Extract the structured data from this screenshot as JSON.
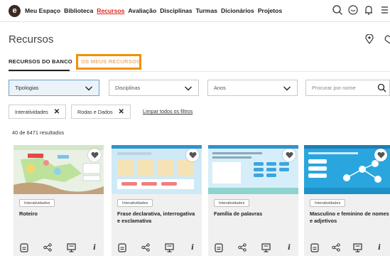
{
  "nav": {
    "logo_letter": "e",
    "links": [
      {
        "label": "Meu Espaço",
        "active": false
      },
      {
        "label": "Biblioteca",
        "active": false
      },
      {
        "label": "Recursos",
        "active": true
      },
      {
        "label": "Avaliação",
        "active": false
      },
      {
        "label": "Disciplinas",
        "active": false
      },
      {
        "label": "Turmas",
        "active": false
      },
      {
        "label": "Dicionários",
        "active": false
      },
      {
        "label": "Projetos",
        "active": false
      }
    ],
    "icons": [
      "search-icon",
      "chat-icon",
      "bell-icon",
      "menu-icon"
    ]
  },
  "page": {
    "title": "Recursos",
    "title_icons": [
      "location-icon",
      "heart-icon"
    ]
  },
  "tabs": {
    "banco": "RECURSOS DO BANCO",
    "meus": "OS MEUS RECURSOS"
  },
  "filters": {
    "tipologias": "Tipologias",
    "disciplinas": "Disciplinas",
    "anos": "Anos",
    "search_placeholder": "Procurar por nome"
  },
  "chips": {
    "chip1": "Interatividades",
    "chip2": "Rodas e Dados",
    "clear": "Limpar todos os filtros"
  },
  "results": "40 de 6471 resultados",
  "cards": [
    {
      "badge": "Interatividades",
      "title": "Roteiro"
    },
    {
      "badge": "Interatividades",
      "title": "Frase declarativa, interrogativa e exclamativa"
    },
    {
      "badge": "Interatividades",
      "title": "Família de palavras"
    },
    {
      "badge": "Interatividades",
      "title": "Masculino e feminino de nomes e adjetivos"
    }
  ],
  "colors": {
    "active_nav": "#d9261c",
    "highlight_box": "#f29100",
    "selected_filter_bg": "#eaf3fa"
  }
}
